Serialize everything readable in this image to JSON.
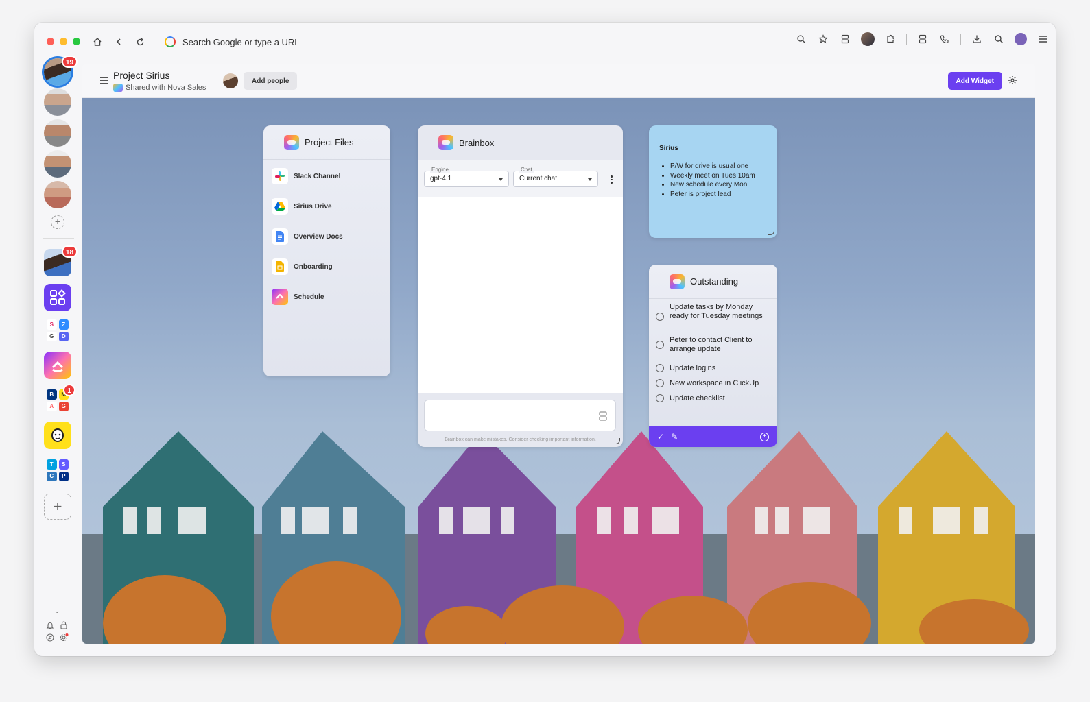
{
  "browser": {
    "url_placeholder": "Search Google or type a URL"
  },
  "sidebar": {
    "badges": {
      "top_avatar": "19",
      "second_avatar": "18",
      "apps_group": "1"
    },
    "app_grid_1": [
      "S",
      "Z",
      "G",
      "D"
    ],
    "app_grid_2": [
      "B",
      "M",
      "A",
      "G"
    ],
    "app_grid_3": [
      "T",
      "S",
      "C",
      "P"
    ]
  },
  "header": {
    "title": "Project Sirius",
    "subtitle": "Shared with Nova Sales",
    "add_people": "Add people",
    "add_widget": "Add Widget"
  },
  "project_files": {
    "title": "Project Files",
    "items": [
      {
        "label": "Slack Channel",
        "icon": "slack-icon"
      },
      {
        "label": "Sirius Drive",
        "icon": "google-drive-icon"
      },
      {
        "label": "Overview Docs",
        "icon": "google-docs-icon"
      },
      {
        "label": "Onboarding",
        "icon": "google-slides-icon"
      },
      {
        "label": "Schedule",
        "icon": "clickup-icon"
      }
    ]
  },
  "brainbox": {
    "title": "Brainbox",
    "engine_label": "Engine",
    "engine_value": "gpt-4.1",
    "chat_label": "Chat",
    "chat_value": "Current chat",
    "disclaimer": "Brainbox can make mistakes. Consider checking important information."
  },
  "note": {
    "title": "Sirius",
    "items": [
      "P/W for drive is usual one",
      "Weekly meet on Tues 10am",
      "New schedule every Mon",
      "Peter is project lead"
    ]
  },
  "outstanding": {
    "title": "Outstanding",
    "tasks": [
      "Update tasks by Monday ready for Tuesday meetings",
      "Peter to contact Client to arrange update",
      "Update logins",
      "New workspace in ClickUp",
      "Update checklist"
    ]
  },
  "colors": {
    "accent": "#6b3ff0",
    "note_bg": "#a7d5f2",
    "badge": "#ec3b3b"
  }
}
